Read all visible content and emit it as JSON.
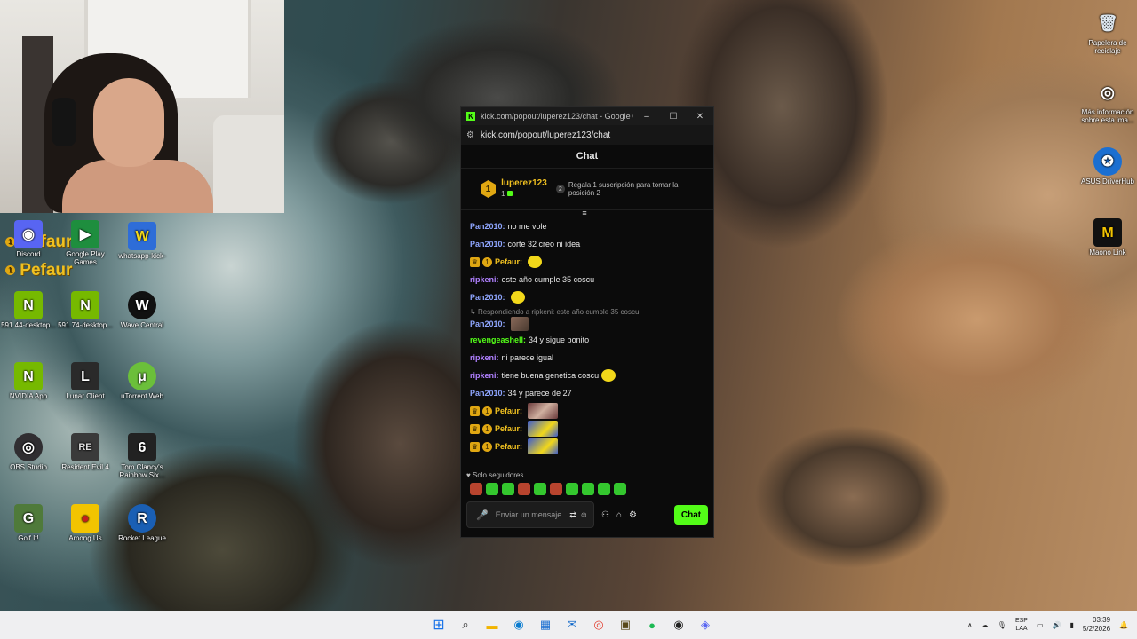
{
  "desktop": {
    "icons": [
      {
        "label": "Discord",
        "glyph": "◉",
        "color": "#5865f2"
      },
      {
        "label": "Google Play Games",
        "glyph": "▶",
        "color": "#1e8e3e"
      },
      {
        "label": "whatsapp-kick-",
        "glyph": "W",
        "color": "#2e6dd8"
      },
      {
        "label": "591.44-desktop...",
        "glyph": "N",
        "color": "#76b900"
      },
      {
        "label": "591.74-desktop...",
        "glyph": "N",
        "color": "#76b900"
      },
      {
        "label": "Wave Central",
        "glyph": "W",
        "color": "#111111"
      },
      {
        "label": "NVIDIA App",
        "glyph": "N",
        "color": "#76b900"
      },
      {
        "label": "Lunar Client",
        "glyph": "L",
        "color": "#2a2a2a"
      },
      {
        "label": "uTorrent Web",
        "glyph": "μ",
        "color": "#6bbf3a"
      },
      {
        "label": "OBS Studio",
        "glyph": "◎",
        "color": "#302e31"
      },
      {
        "label": "Resident Evil 4",
        "glyph": "RE",
        "color": "#3a3a3a"
      },
      {
        "label": "Tom Clancy's Rainbow Six...",
        "glyph": "6",
        "color": "#222222"
      },
      {
        "label": "Golf It!",
        "glyph": "G",
        "color": "#4f7a3a"
      },
      {
        "label": "Among Us",
        "glyph": "●",
        "color": "#c41e1e"
      },
      {
        "label": "Rocket League",
        "glyph": "R",
        "color": "#1a5fb4"
      }
    ],
    "right_icons": [
      {
        "label": "Papelera de reciclaje",
        "glyph": "🗑"
      },
      {
        "label": "Más información sobre esta ima...",
        "glyph": "◎"
      },
      {
        "label": "ASUS DriverHub",
        "glyph": "✪"
      },
      {
        "label": "Maono Link",
        "glyph": "M"
      }
    ],
    "overlay_names": [
      "Pefaur",
      "Pefaur"
    ]
  },
  "browser": {
    "title": "kick.com/popout/luperez123/chat - Google Chr...",
    "url": "kick.com/popout/luperez123/chat",
    "minimize": "–",
    "maximize": "☐",
    "close": "✕"
  },
  "chat": {
    "header": "Chat",
    "sub_user": "luperez123",
    "sub_count": "1",
    "gift_text": "Regala 1 suscripción para tomar la posición 2",
    "reply_text": "Respondiendo a ripkeni: este año cumple 35 coscu",
    "followers_only": "Solo seguidores",
    "input_placeholder": "Enviar un mensaje",
    "send_label": "Chat",
    "messages": [
      {
        "user": "Pan2010:",
        "text": "no me vole",
        "color": "blue"
      },
      {
        "user": "Pan2010:",
        "text": "corte 32 creo ni idea",
        "color": "blue"
      },
      {
        "user": "Pefaur:",
        "text": "",
        "color": "gold"
      },
      {
        "user": "ripkeni:",
        "text": "este año cumple 35 coscu",
        "color": "purple"
      },
      {
        "user": "Pan2010:",
        "text": "",
        "color": "blue"
      },
      {
        "user": "Pan2010:",
        "text": "",
        "color": "blue"
      },
      {
        "user": "revengeashell:",
        "text": "34 y sigue bonito",
        "color": "green"
      },
      {
        "user": "ripkeni:",
        "text": "ni parece igual",
        "color": "purple"
      },
      {
        "user": "ripkeni:",
        "text": "tiene buena genetica coscu",
        "color": "purple"
      },
      {
        "user": "Pan2010:",
        "text": "34 y parece de 27",
        "color": "blue"
      },
      {
        "user": "Pefaur:",
        "text": "",
        "color": "gold"
      },
      {
        "user": "Pefaur:",
        "text": "",
        "color": "gold"
      },
      {
        "user": "Pefaur:",
        "text": "",
        "color": "gold"
      }
    ]
  },
  "taskbar": {
    "lang_top": "ESP",
    "lang_bottom": "LAA",
    "time": "03:39",
    "date": "5/2/2026"
  }
}
